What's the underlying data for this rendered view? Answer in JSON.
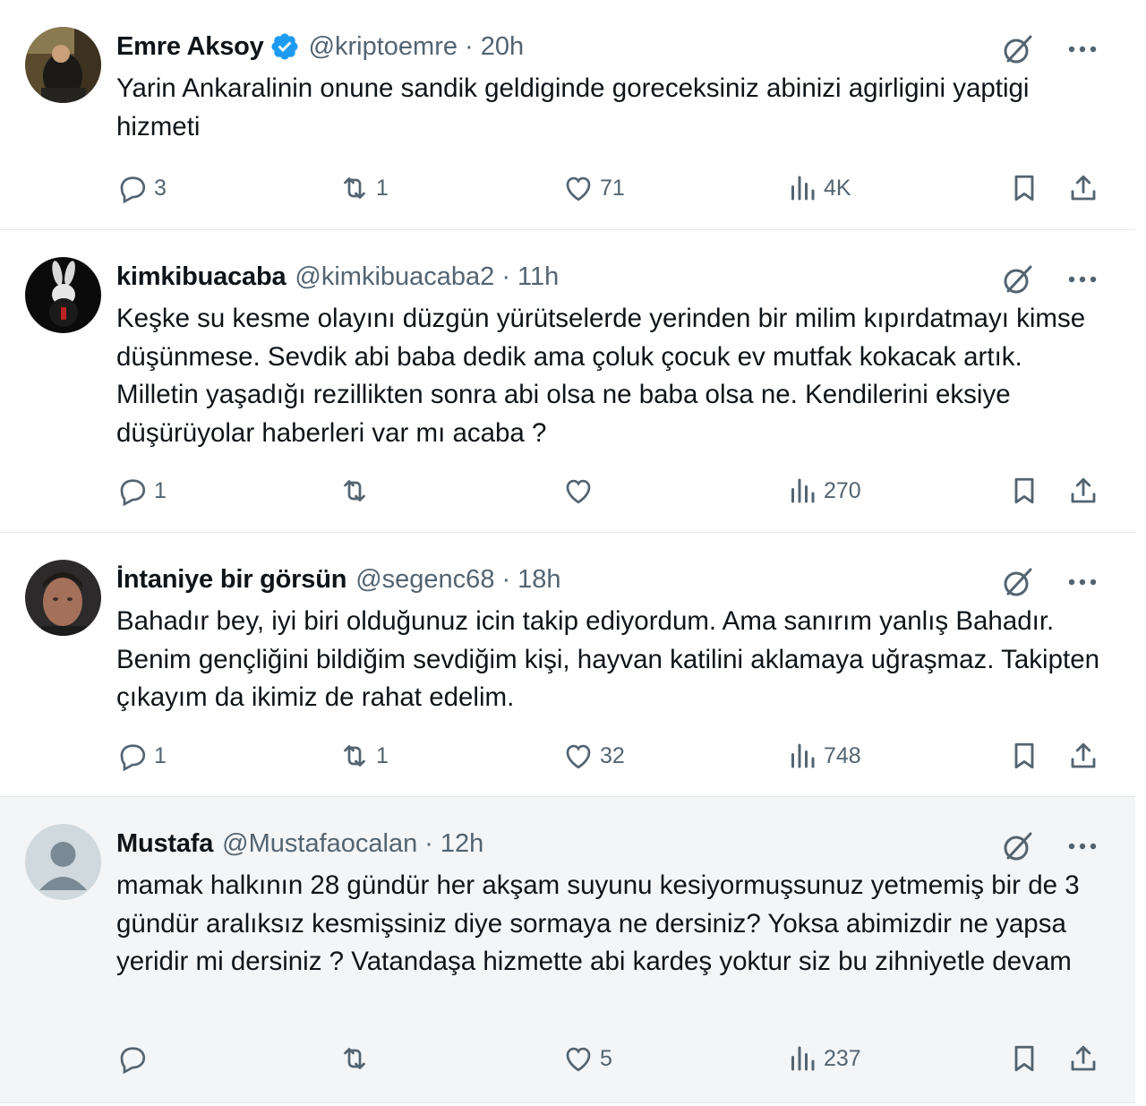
{
  "tweets": [
    {
      "name": "Emre Aksoy",
      "verified": true,
      "handle": "@kriptoemre",
      "dot": "·",
      "time": "20h",
      "text": "Yarin Ankaralinin onune sandik geldiginde goreceksiniz abinizi agirligini yaptigi hizmeti",
      "replies": "3",
      "reposts": "1",
      "likes": "71",
      "views": "4K",
      "avatar_icon": "photo-man-sitting"
    },
    {
      "name": "kimkibuacaba",
      "verified": false,
      "handle": "@kimkibuacaba2",
      "dot": "·",
      "time": "11h",
      "text": "Keşke su kesme olayını düzgün yürütselerde yerinden bir milim kıpırdatmayı kimse düşünmese. Sevdik abi baba dedik ama çoluk çocuk ev mutfak kokacak artık. Milletin yaşadığı rezillikten sonra abi olsa ne baba olsa ne. Kendilerini eksiye düşürüyolar haberleri var mı acaba ?",
      "replies": "1",
      "reposts": "",
      "likes": "",
      "views": "270",
      "avatar_icon": "rabbit-silhouette"
    },
    {
      "name": "İntaniye bir görsün",
      "verified": false,
      "handle": "@segenc68",
      "dot": "·",
      "time": "18h",
      "text": "Bahadır bey, iyi biri olduğunuz icin takip ediyordum. Ama sanırım yanlış Bahadır. Benim gençliğini bildiğim sevdiğim kişi, hayvan katilini aklamaya uğraşmaz. Takipten çıkayım da ikimiz de rahat edelim.",
      "replies": "1",
      "reposts": "1",
      "likes": "32",
      "views": "748",
      "avatar_icon": "photo-man-portrait"
    },
    {
      "name": "Mustafa",
      "verified": false,
      "handle": "@Mustafaocalan",
      "dot": "·",
      "time": "12h",
      "text": "mamak halkının 28 gündür her akşam suyunu kesiyormuşsunuz yetmemiş bir de 3 gündür aralıksız kesmişsiniz diye sormaya ne dersiniz? Yoksa abimizdir ne yapsa yeridir mi dersiniz ? Vatandaşa hizmette abi kardeş yoktur siz bu zihniyetle devam",
      "replies": "",
      "reposts": "",
      "likes": "5",
      "views": "237",
      "avatar_icon": "default-profile"
    }
  ],
  "icons": {
    "reply": "reply-icon",
    "repost": "repost-icon",
    "like": "like-icon",
    "views": "views-icon",
    "bookmark": "bookmark-icon",
    "share": "share-icon",
    "grok": "grok-icon",
    "more": "more-icon",
    "verified": "verified-badge-icon"
  },
  "colors": {
    "text": "#0f1419",
    "secondary": "#536471",
    "verified": "#1d9bf0",
    "divider": "#e6e9eb",
    "highlight_bg": "#f4f5f6"
  }
}
